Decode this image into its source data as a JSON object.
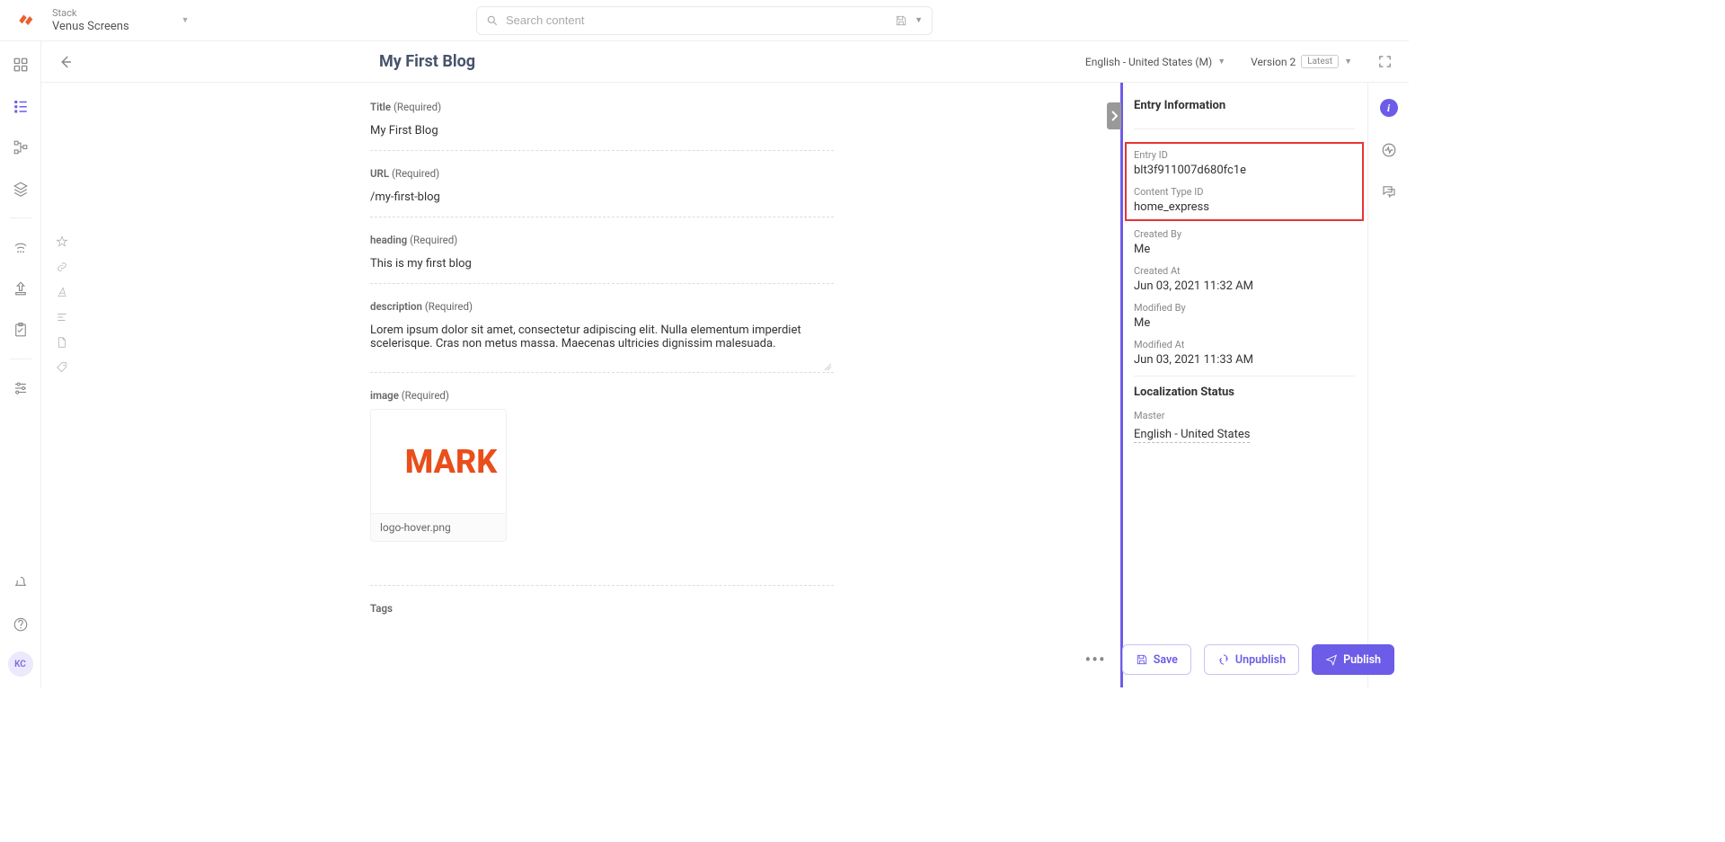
{
  "header": {
    "stack_label": "Stack",
    "stack_name": "Venus Screens",
    "search_placeholder": "Search content"
  },
  "entry_header": {
    "title": "My First Blog",
    "language": "English - United States (M)",
    "version": "Version 2",
    "version_badge": "Latest"
  },
  "fields": {
    "title": {
      "label": "Title",
      "req": "(Required)",
      "value": "My First Blog"
    },
    "url": {
      "label": "URL",
      "req": "(Required)",
      "value": "/my-first-blog"
    },
    "heading": {
      "label": "heading",
      "req": "(Required)",
      "value": "This is my first blog"
    },
    "description": {
      "label": "description",
      "req": "(Required)",
      "value": "Lorem ipsum dolor sit amet, consectetur adipiscing elit. Nulla elementum imperdiet scelerisque. Cras non metus massa. Maecenas ultricies dignissim malesuada."
    },
    "image": {
      "label": "image",
      "req": "(Required)",
      "filename": "logo-hover.png",
      "preview_text": "MARK"
    },
    "tags": {
      "label": "Tags"
    }
  },
  "info_panel": {
    "title": "Entry Information",
    "entry_id": {
      "label": "Entry ID",
      "value": "blt3f911007d680fc1e"
    },
    "content_type_id": {
      "label": "Content Type ID",
      "value": "home_express"
    },
    "created_by": {
      "label": "Created By",
      "value": "Me"
    },
    "created_at": {
      "label": "Created At",
      "value": "Jun 03, 2021 11:32 AM"
    },
    "modified_by": {
      "label": "Modified By",
      "value": "Me"
    },
    "modified_at": {
      "label": "Modified At",
      "value": "Jun 03, 2021 11:33 AM"
    },
    "localization_title": "Localization Status",
    "master": {
      "label": "Master",
      "value": "English - United States"
    }
  },
  "footer": {
    "save": "Save",
    "unpublish": "Unpublish",
    "publish": "Publish"
  },
  "avatar": "KC"
}
